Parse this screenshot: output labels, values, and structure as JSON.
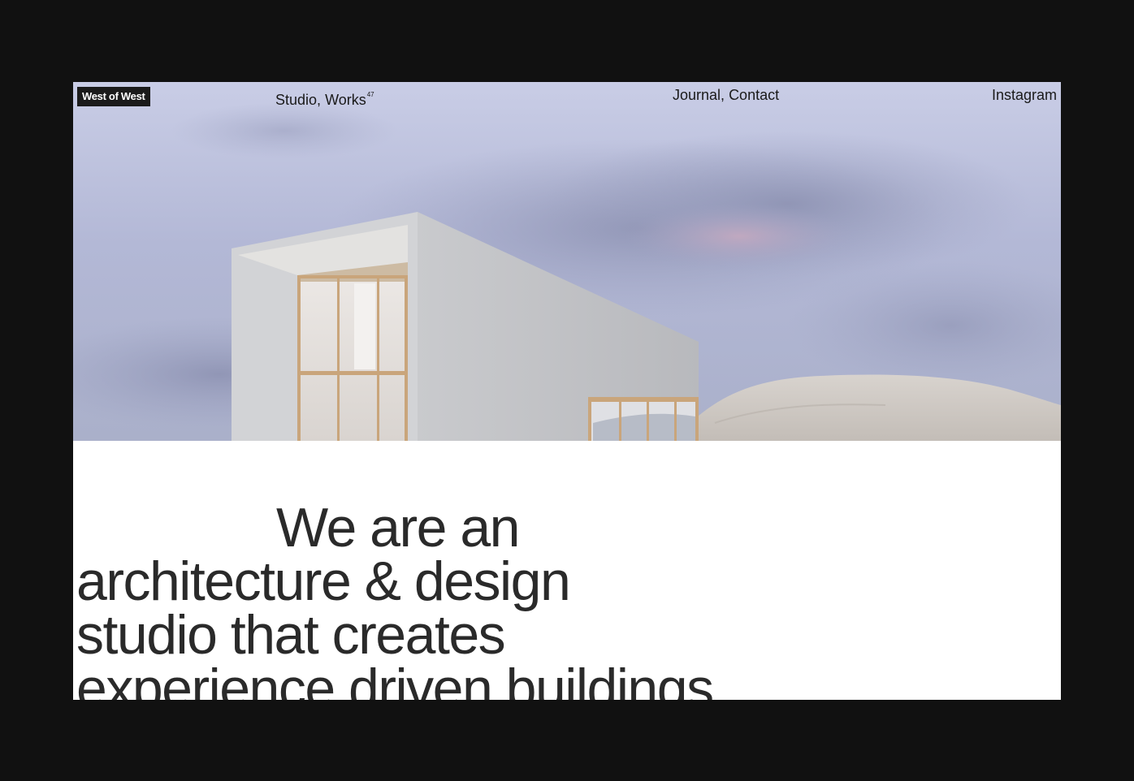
{
  "brand": {
    "logo_text": "West of West"
  },
  "nav": {
    "studio": "Studio",
    "separator": ", ",
    "works": "Works",
    "works_count": "47",
    "journal": "Journal",
    "contact": "Contact",
    "instagram": "Instagram"
  },
  "hero": {
    "image_subject": "concrete-house-on-dune-rendering"
  },
  "intro": {
    "lines": [
      "We are an",
      "architecture & design",
      "studio that creates",
      "experience driven buildings"
    ]
  },
  "colors": {
    "frame": "#111111",
    "page": "#ffffff",
    "text": "#2a2a2a",
    "logo_bg": "#1b1b1b"
  }
}
